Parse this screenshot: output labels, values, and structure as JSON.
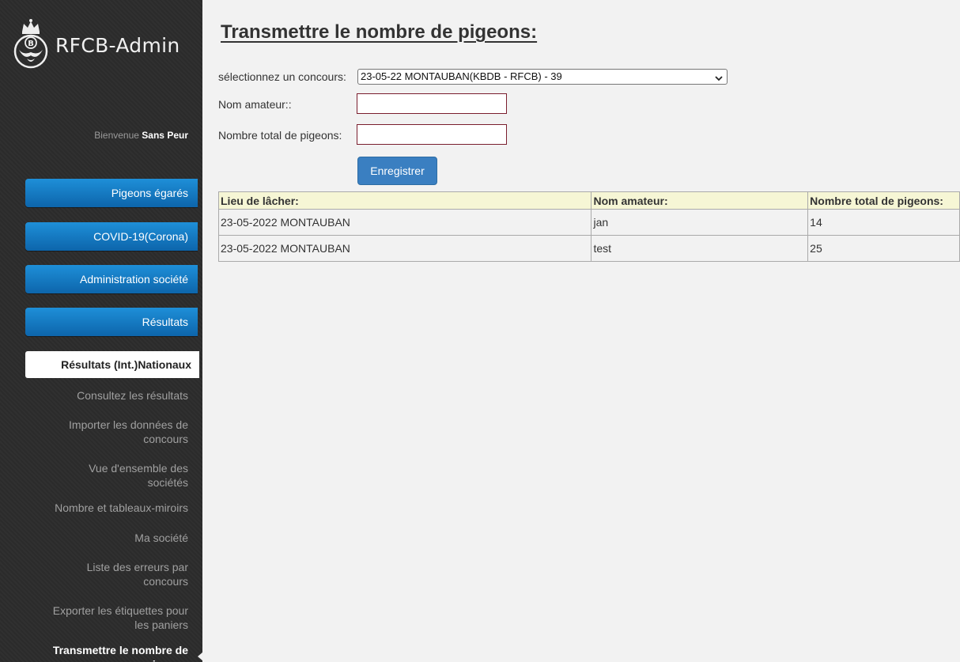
{
  "app": {
    "name": "RFCB-Admin"
  },
  "welcome": {
    "prefix": "Bienvenue",
    "user": "Sans Peur"
  },
  "nav": {
    "buttons": [
      "Pigeons égarés",
      "COVID-19(Corona)",
      "Administration société",
      "Résultats"
    ],
    "active_section": "Résultats (Int.)Nationaux",
    "sub_items": [
      {
        "lines": [
          "Consultez les résultats"
        ]
      },
      {
        "lines": [
          "Importer les données de",
          "concours"
        ]
      },
      {
        "lines": [
          "Vue d'ensemble des",
          "sociétés"
        ]
      },
      {
        "lines": [
          "Nombre et tableaux-miroirs"
        ]
      },
      {
        "lines": [
          "Ma société"
        ]
      },
      {
        "lines": [
          "Liste des erreurs par",
          "concours"
        ]
      },
      {
        "lines": [
          "Exporter les étiquettes pour",
          "les paniers"
        ]
      },
      {
        "lines": [
          "Transmettre le nombre de",
          "pigeons"
        ]
      }
    ]
  },
  "page": {
    "title": "Transmettre le nombre de pigeons:",
    "form": {
      "contest_label": "sélectionnez un concours:",
      "contest_value": "23-05-22 MONTAUBAN(KBDB - RFCB) - 39",
      "amateur_label": "Nom amateur::",
      "amateur_value": "",
      "total_label": "Nombre total de pigeons:",
      "total_value": "",
      "save_label": "Enregistrer"
    },
    "table": {
      "headers": [
        "Lieu de lâcher:",
        "Nom amateur:",
        "Nombre total de pigeons:"
      ],
      "rows": [
        [
          "23-05-2022 MONTAUBAN",
          "jan",
          "14"
        ],
        [
          "23-05-2022 MONTAUBAN",
          "test",
          "25"
        ]
      ]
    }
  },
  "icons": {
    "logo": "rfcb-pigeon-crown-icon",
    "select_chevron": "chevron-down-icon"
  },
  "colors": {
    "nav_button": "#1e8fd8",
    "save_button": "#3a7fc1",
    "table_header": "#f6f6d5",
    "sidebar": "#2b2b2b"
  }
}
